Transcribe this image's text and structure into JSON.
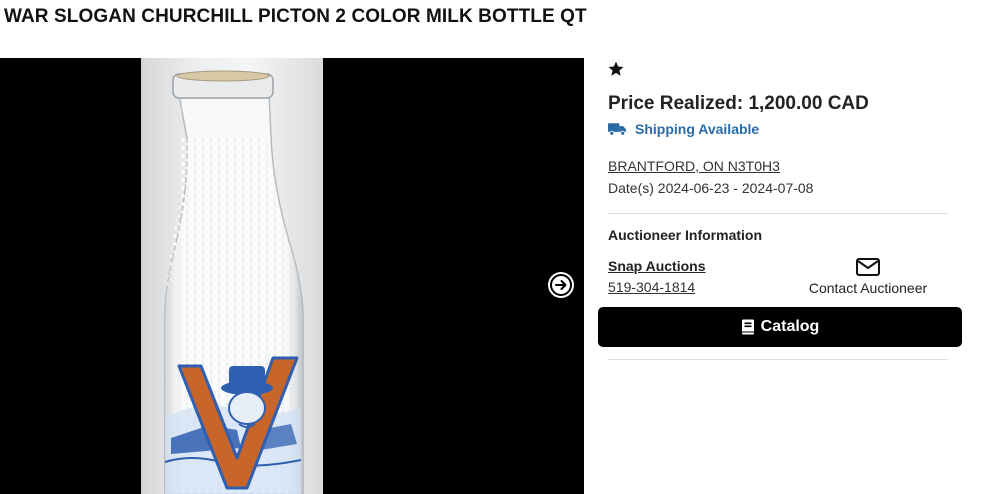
{
  "listing": {
    "title": "WAR SLOGAN CHURCHILL PICTON 2 COLOR MILK BOTTLE QT"
  },
  "details": {
    "price_realized": "Price Realized: 1,200.00 CAD",
    "shipping": "Shipping Available",
    "location": "BRANTFORD, ON N3T0H3",
    "dates_label": "Date(s)",
    "dates_value": "2024-06-23 - 2024-07-08"
  },
  "auctioneer": {
    "heading": "Auctioneer Information",
    "name": "Snap Auctions",
    "phone": "519-304-1814",
    "contact_label": "Contact Auctioneer"
  },
  "actions": {
    "catalog_label": "Catalog"
  },
  "icons": {
    "favorite": "star-icon",
    "shipping": "truck-icon",
    "contact": "envelope-icon",
    "catalog": "book-icon",
    "next": "arrow-right-circle-icon"
  },
  "colors": {
    "shipping_text": "#2a6aa5",
    "catalog_button": "#000000",
    "viewer_background": "#000000",
    "bottle_print_blue": "#2f5fb0",
    "bottle_print_orange": "#c8652a"
  }
}
